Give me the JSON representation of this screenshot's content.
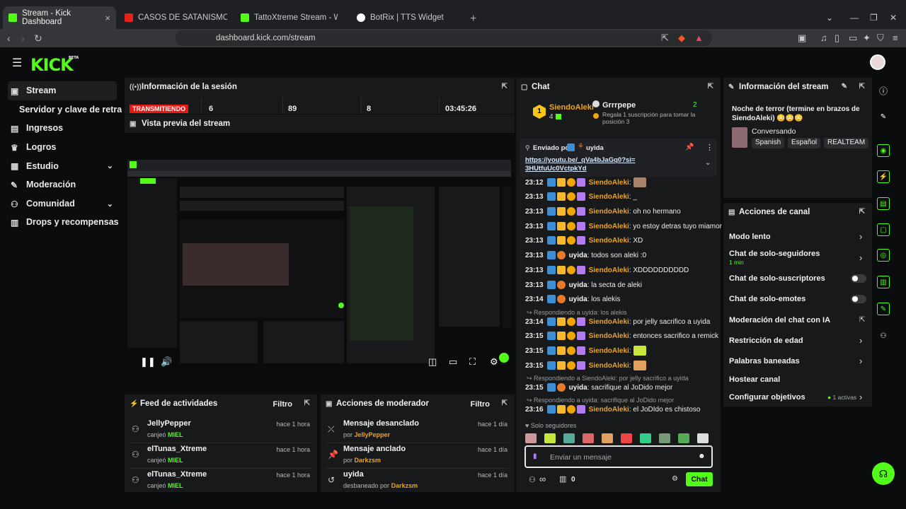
{
  "browser": {
    "tabs": [
      {
        "title": "Stream - Kick Dashboard",
        "fav": "#53fc18"
      },
      {
        "title": "CASOS DE SATANISMO EN MÉXICO",
        "fav": "#e62117"
      },
      {
        "title": "TattoXtreme Stream - Watch Live",
        "fav": "#53fc18"
      },
      {
        "title": "BotRix | TTS Widget",
        "fav": "#ffffff"
      }
    ],
    "url": "dashboard.kick.com/stream"
  },
  "app": {
    "logo": "KICK",
    "logo_beta": "BETA"
  },
  "sidebar": {
    "items": [
      {
        "label": "Stream",
        "icon": "camera-icon",
        "glyph": "▣"
      },
      {
        "label": "Servidor y clave de retransmisión",
        "icon": "",
        "glyph": ""
      },
      {
        "label": "Ingresos",
        "icon": "chart-icon",
        "glyph": "▤"
      },
      {
        "label": "Logros",
        "icon": "trophy-icon",
        "glyph": "🏆"
      },
      {
        "label": "Estudio",
        "icon": "studio-icon",
        "glyph": "▦"
      },
      {
        "label": "Moderación",
        "icon": "wrench-icon",
        "glyph": "🔧"
      },
      {
        "label": "Comunidad",
        "icon": "community-icon",
        "glyph": "👥"
      },
      {
        "label": "Drops y recompensas",
        "icon": "drops-icon",
        "glyph": "▥"
      }
    ]
  },
  "session": {
    "title": "Información de la sesión",
    "status": "TRANSMITIENDO",
    "stats": [
      "6",
      "89",
      "8",
      "03:45:26"
    ]
  },
  "preview": {
    "title": "Vista previa del stream"
  },
  "feed": {
    "title": "Feed de actividades",
    "filter": "Filtro",
    "items": [
      {
        "name": "JellyPepper",
        "verb": "canjeó",
        "item": "MIEL",
        "time": "hace 1 hora"
      },
      {
        "name": "elTunas_Xtreme",
        "verb": "canjeó",
        "item": "MIEL",
        "time": "hace 1 hora"
      },
      {
        "name": "elTunas_Xtreme",
        "verb": "canjeó",
        "item": "MIEL",
        "time": "hace 1 hora"
      }
    ]
  },
  "modactions": {
    "title": "Acciones de moderador",
    "filter": "Filtro",
    "items": [
      {
        "name": "Mensaje desanclado",
        "verb": "por",
        "item": "JellyPepper",
        "time": "hace 1 día"
      },
      {
        "name": "Mensaje anclado",
        "verb": "por",
        "item": "Darkzsm",
        "time": "hace 1 día"
      },
      {
        "name": "uyida",
        "verb": "desbaneado por",
        "item": "Darkzsm",
        "time": "hace 1 día"
      }
    ]
  },
  "chat": {
    "title": "Chat",
    "top_gifter": {
      "name": "SiendoAleki",
      "count": "4",
      "rank": "1"
    },
    "gift_promo": {
      "name": "Grrrpepe",
      "count": "2",
      "text": "Regala 1 suscripción para tomar la posición 3"
    },
    "pinned": {
      "label": "Enviado por",
      "user": "uyida",
      "link": "https://youtu.be/_qVa4bJaGq0?si=3HUtfuUc0VctpkYd"
    },
    "messages": [
      {
        "time": "23:12",
        "user": "SiendoAleki",
        "text": ":",
        "badges": 4,
        "emote": "#a8836a"
      },
      {
        "time": "23:13",
        "user": "SiendoAleki",
        "text": ": _",
        "badges": 4
      },
      {
        "time": "23:13",
        "user": "SiendoAleki",
        "text": ": oh no hermano",
        "badges": 4
      },
      {
        "time": "23:13",
        "user": "SiendoAleki",
        "text": ": yo estoy detras tuyo miamor",
        "badges": 4
      },
      {
        "time": "23:13",
        "user": "SiendoAleki",
        "text": ": XD",
        "badges": 4
      },
      {
        "time": "23:13",
        "user": "uyida",
        "text": ": todos son aleki :0",
        "badges": 2
      },
      {
        "time": "23:13",
        "user": "SiendoAleki",
        "text": ": XDDDDDDDDDD",
        "badges": 4
      },
      {
        "time": "23:13",
        "user": "uyida",
        "text": ": la secta de aleki",
        "badges": 2
      },
      {
        "time": "23:14",
        "user": "uyida",
        "text": ": los alekis",
        "badges": 2
      },
      {
        "reply": "Respondiendo a uyida: los alekis"
      },
      {
        "time": "23:14",
        "user": "SiendoAleki",
        "text": ": por jelly sacrifico a uyida",
        "badges": 4
      },
      {
        "time": "23:15",
        "user": "SiendoAleki",
        "text": ": entonces sacrifico a remick",
        "badges": 4
      },
      {
        "time": "23:15",
        "user": "SiendoAleki",
        "text": ":",
        "badges": 4,
        "emote": "#c7e63b"
      },
      {
        "time": "23:15",
        "user": "SiendoAleki",
        "text": ":",
        "badges": 4,
        "emote": "#e0a060"
      },
      {
        "reply": "Respondiendo a SiendoAleki: por jelly sacrifico a uyida"
      },
      {
        "time": "23:15",
        "user": "uyida",
        "text": ": sacrifique al JoDido mejor",
        "badges": 2
      },
      {
        "reply": "Respondiendo a uyida: sacrifique al JoDido mejor"
      },
      {
        "time": "23:16",
        "user": "SiendoAleki",
        "text": ": el JoDIdo es chistoso",
        "badges": 4
      }
    ],
    "mode": "Solo seguidores",
    "emote_colors": [
      "#c99",
      "#c7e63b",
      "#5a9",
      "#d66",
      "#e0a060",
      "#e44",
      "#3c8",
      "#797",
      "#5a5",
      "#ddd"
    ],
    "input_placeholder": "Enviar un mensaje",
    "count": "0",
    "send_label": "Chat",
    "infinity": "∞"
  },
  "stream_info": {
    "title": "Información del stream",
    "stream_title": "Noche de terror (termine en brazos de SiendoAleki) 😳😳😳",
    "category": "Conversando",
    "tags": [
      "Spanish",
      "Español",
      "REALTEAM"
    ]
  },
  "channel_actions": {
    "title": "Acciones de canal",
    "items": [
      {
        "label": "Modo lento",
        "control": "chevron"
      },
      {
        "label": "Chat de solo-seguidores",
        "sub": "1 min",
        "control": "chevron"
      },
      {
        "label": "Chat de solo-suscriptores",
        "control": "toggle"
      },
      {
        "label": "Chat de solo-emotes",
        "control": "toggle"
      },
      {
        "label": "Moderación del chat con IA",
        "control": "external"
      },
      {
        "label": "Restricción de edad",
        "control": "chevron"
      },
      {
        "label": "Palabras baneadas",
        "control": "chevron"
      },
      {
        "label": "Hostear canal",
        "control": "none"
      },
      {
        "label": "Configurar objetivos",
        "badge": "1 activas",
        "control": "chevron"
      }
    ]
  },
  "colors": {
    "accent": "#53fc18",
    "live": "#e91916",
    "username": "#f2a319"
  }
}
